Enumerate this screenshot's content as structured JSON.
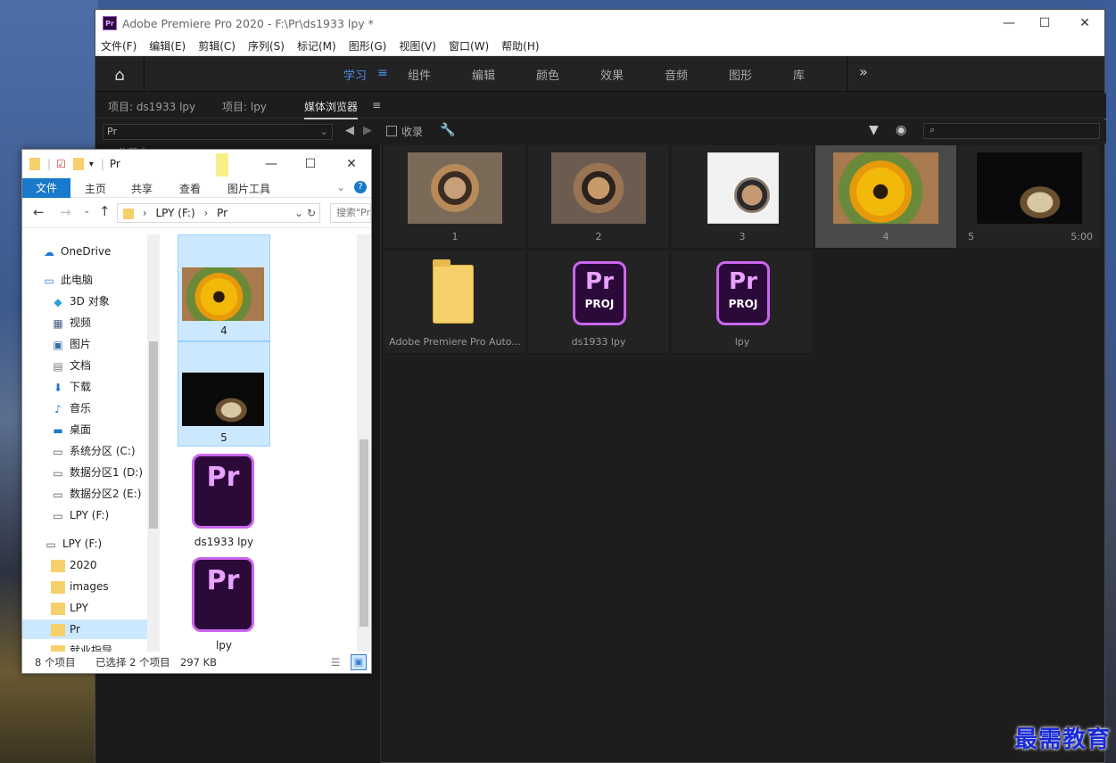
{
  "premiere": {
    "title": "Adobe Premiere Pro 2020 - F:\\Pr\\ds1933 lpy *",
    "logo": "Pr",
    "window_controls": {
      "minimize": "—",
      "maximize": "☐",
      "close": "✕"
    },
    "menu": [
      "文件(F)",
      "编辑(E)",
      "剪辑(C)",
      "序列(S)",
      "标记(M)",
      "图形(G)",
      "视图(V)",
      "窗口(W)",
      "帮助(H)"
    ],
    "workspace_tabs": [
      "学习",
      "组件",
      "编辑",
      "颜色",
      "效果",
      "音频",
      "图形",
      "库"
    ],
    "active_workspace": "学习",
    "overflow": "»",
    "panel_tabs": [
      "项目: ds1933 lpy",
      "项目: lpy",
      "媒体浏览器"
    ],
    "active_panel": "媒体浏览器",
    "media_browser": {
      "location": "Pr",
      "collect_label": "收录",
      "search_placeholder": "",
      "left_stub": "收藏夹"
    },
    "items": [
      {
        "label": "1",
        "kind": "food-photo"
      },
      {
        "label": "2",
        "kind": "food-photo"
      },
      {
        "label": "3",
        "kind": "food-sketch"
      },
      {
        "label": "4",
        "kind": "sunflower-photo",
        "selected": true
      },
      {
        "label": "5",
        "kind": "night-photo",
        "duration": "5:00"
      },
      {
        "label": "Adobe Premiere Pro Auto...",
        "kind": "folder"
      },
      {
        "label": "ds1933 lpy",
        "kind": "prproj"
      },
      {
        "label": "lpy",
        "kind": "prproj"
      }
    ],
    "prproj_icon": {
      "top": "Pr",
      "bottom": "PROJ"
    }
  },
  "explorer": {
    "title": "Pr",
    "window_controls": {
      "minimize": "—",
      "maximize": "☐",
      "close": "✕"
    },
    "ribbon_tabs": [
      "文件",
      "主页",
      "共享",
      "查看",
      "图片工具"
    ],
    "address": "LPY (F:)  >  Pr",
    "address_root": "LPY (F:)",
    "address_leaf": "Pr",
    "search_placeholder": "搜索\"Pr\"",
    "tree": [
      {
        "label": "OneDrive",
        "icon": "cloud-icon"
      },
      {
        "label": "此电脑",
        "icon": "computer-icon"
      },
      {
        "label": "3D 对象",
        "icon": "cube-icon"
      },
      {
        "label": "视频",
        "icon": "video-icon"
      },
      {
        "label": "图片",
        "icon": "picture-icon"
      },
      {
        "label": "文档",
        "icon": "document-icon"
      },
      {
        "label": "下载",
        "icon": "download-icon"
      },
      {
        "label": "音乐",
        "icon": "music-icon"
      },
      {
        "label": "桌面",
        "icon": "desktop-icon"
      },
      {
        "label": "系统分区 (C:)",
        "icon": "drive-icon"
      },
      {
        "label": "数据分区1 (D:)",
        "icon": "drive-icon"
      },
      {
        "label": "数据分区2 (E:)",
        "icon": "drive-icon"
      },
      {
        "label": "LPY (F:)",
        "icon": "drive-icon"
      },
      {
        "label": "LPY (F:)",
        "icon": "drive-icon"
      },
      {
        "label": "2020",
        "icon": "folder-icon"
      },
      {
        "label": "images",
        "icon": "folder-icon"
      },
      {
        "label": "LPY",
        "icon": "folder-icon"
      },
      {
        "label": "Pr",
        "icon": "folder-icon",
        "selected": true
      },
      {
        "label": "就业指导",
        "icon": "folder-icon"
      }
    ],
    "files": [
      {
        "label": "4",
        "kind": "sunflower-photo",
        "selected": true
      },
      {
        "label": "5",
        "kind": "night-photo",
        "selected": true
      },
      {
        "label": "ds1933 lpy",
        "kind": "prproj"
      },
      {
        "label": "lpy",
        "kind": "prproj"
      }
    ],
    "status": {
      "count": "8 个项目",
      "selection": "已选择 2 个项目",
      "size": "297 KB"
    }
  },
  "watermark": "最需教育"
}
